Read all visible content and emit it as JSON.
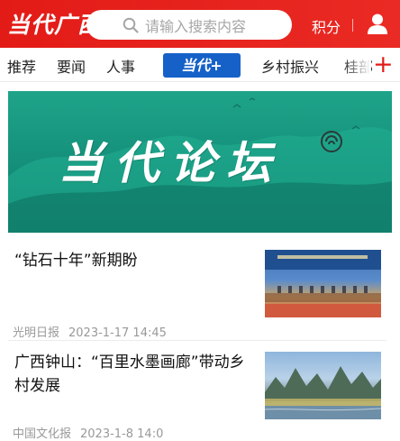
{
  "header": {
    "logo_text": "当代广西",
    "search_placeholder": "请输入搜索内容",
    "points_label": "积分",
    "colors": {
      "brand_red": "#e31b17",
      "nav_blue": "#1561c8"
    },
    "icons": [
      "search-icon",
      "user-icon"
    ]
  },
  "nav": {
    "items": [
      "推荐",
      "要闻",
      "人事",
      "乡村振兴",
      "桂部"
    ],
    "badge_label": "当代+",
    "plus_label": "+"
  },
  "banner": {
    "title": "当代论坛"
  },
  "articles": [
    {
      "title": "“钻石十年”新期盼",
      "source": "光明日报",
      "time": "2023-1-17 14:45"
    },
    {
      "title": "广西钟山：“百里水墨画廊”带动乡村发展",
      "source": "中国文化报",
      "time": "2023-1-8 14:0"
    }
  ]
}
